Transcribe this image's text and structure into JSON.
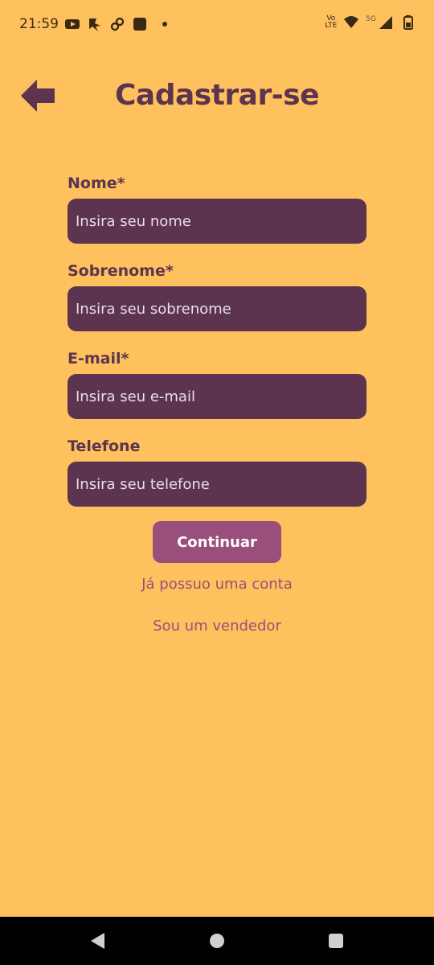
{
  "status_bar": {
    "time": "21:59",
    "left_icons": [
      "youtube-icon",
      "pinwheel-icon",
      "link-icon",
      "app-square-icon"
    ],
    "right_icons": [
      "volte-lte-icon",
      "wifi-icon",
      "signal-5g-icon",
      "battery-icon"
    ],
    "lte_top": "Vo",
    "lte_bottom": "LTE",
    "network_label": "5G"
  },
  "header": {
    "back_icon": "back-arrow-icon",
    "title": "Cadastrar-se"
  },
  "form": {
    "fields": [
      {
        "label": "Nome*",
        "placeholder": "Insira seu nome",
        "value": ""
      },
      {
        "label": "Sobrenome*",
        "placeholder": "Insira seu sobrenome",
        "value": ""
      },
      {
        "label": "E-mail*",
        "placeholder": "Insira seu e-mail",
        "value": ""
      },
      {
        "label": "Telefone",
        "placeholder": "Insira seu telefone",
        "value": ""
      }
    ],
    "continue_label": "Continuar",
    "have_account_link": "Já possuo uma conta",
    "seller_link": "Sou um vendedor"
  },
  "nav_bar": {
    "buttons": [
      "nav-back-icon",
      "nav-home-icon",
      "nav-recents-icon"
    ]
  },
  "colors": {
    "background": "#FFC15E",
    "primary": "#5C344F",
    "accent": "#9A4E7B",
    "input_text": "#EBDDE8"
  }
}
